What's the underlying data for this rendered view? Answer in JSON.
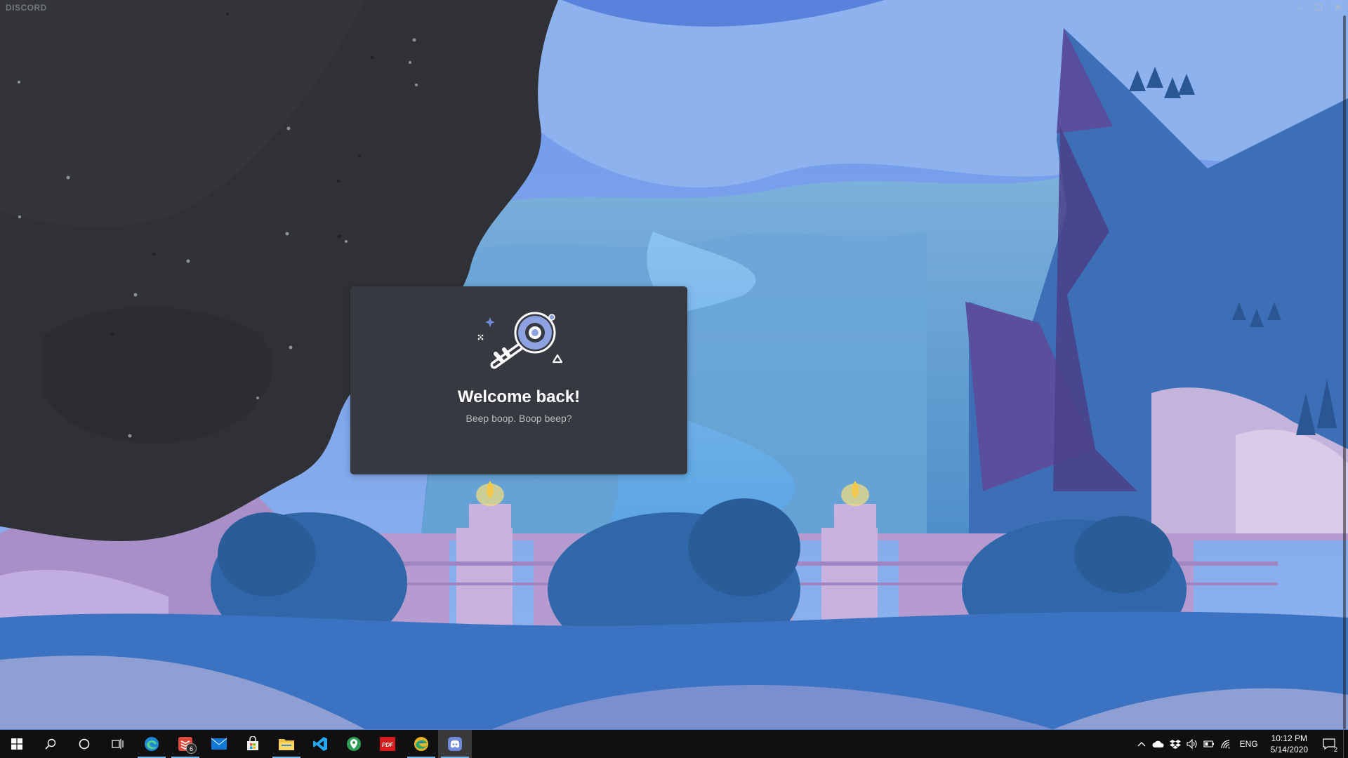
{
  "window": {
    "app_name": "DISCORD",
    "controls": {
      "minimize": "–",
      "maximize": "☐",
      "close": "✕"
    }
  },
  "login_card": {
    "title": "Welcome back!",
    "subtitle": "Beep boop. Boop beep?"
  },
  "taskbar": {
    "apps": [
      {
        "name": "start",
        "icon": "windows-logo-icon"
      },
      {
        "name": "search",
        "icon": "search-icon"
      },
      {
        "name": "cortana",
        "icon": "cortana-icon"
      },
      {
        "name": "task-view",
        "icon": "task-view-icon"
      },
      {
        "name": "edge",
        "icon": "edge-icon",
        "active": true
      },
      {
        "name": "todoist",
        "icon": "todoist-icon",
        "active": true,
        "badge": "6"
      },
      {
        "name": "mail",
        "icon": "mail-icon"
      },
      {
        "name": "store",
        "icon": "store-icon"
      },
      {
        "name": "file-explorer",
        "icon": "folder-icon",
        "active": true
      },
      {
        "name": "vscode",
        "icon": "vscode-icon"
      },
      {
        "name": "maps",
        "icon": "maps-pin-icon"
      },
      {
        "name": "pdf",
        "icon": "pdf-icon",
        "label": "PDF"
      },
      {
        "name": "edge-canary",
        "icon": "edge-canary-icon",
        "active": true
      },
      {
        "name": "discord",
        "icon": "discord-icon",
        "active": true,
        "focused": true
      }
    ],
    "tray": {
      "language": "ENG",
      "time": "10:12 PM",
      "date": "5/14/2020",
      "notification_count": "2"
    }
  }
}
